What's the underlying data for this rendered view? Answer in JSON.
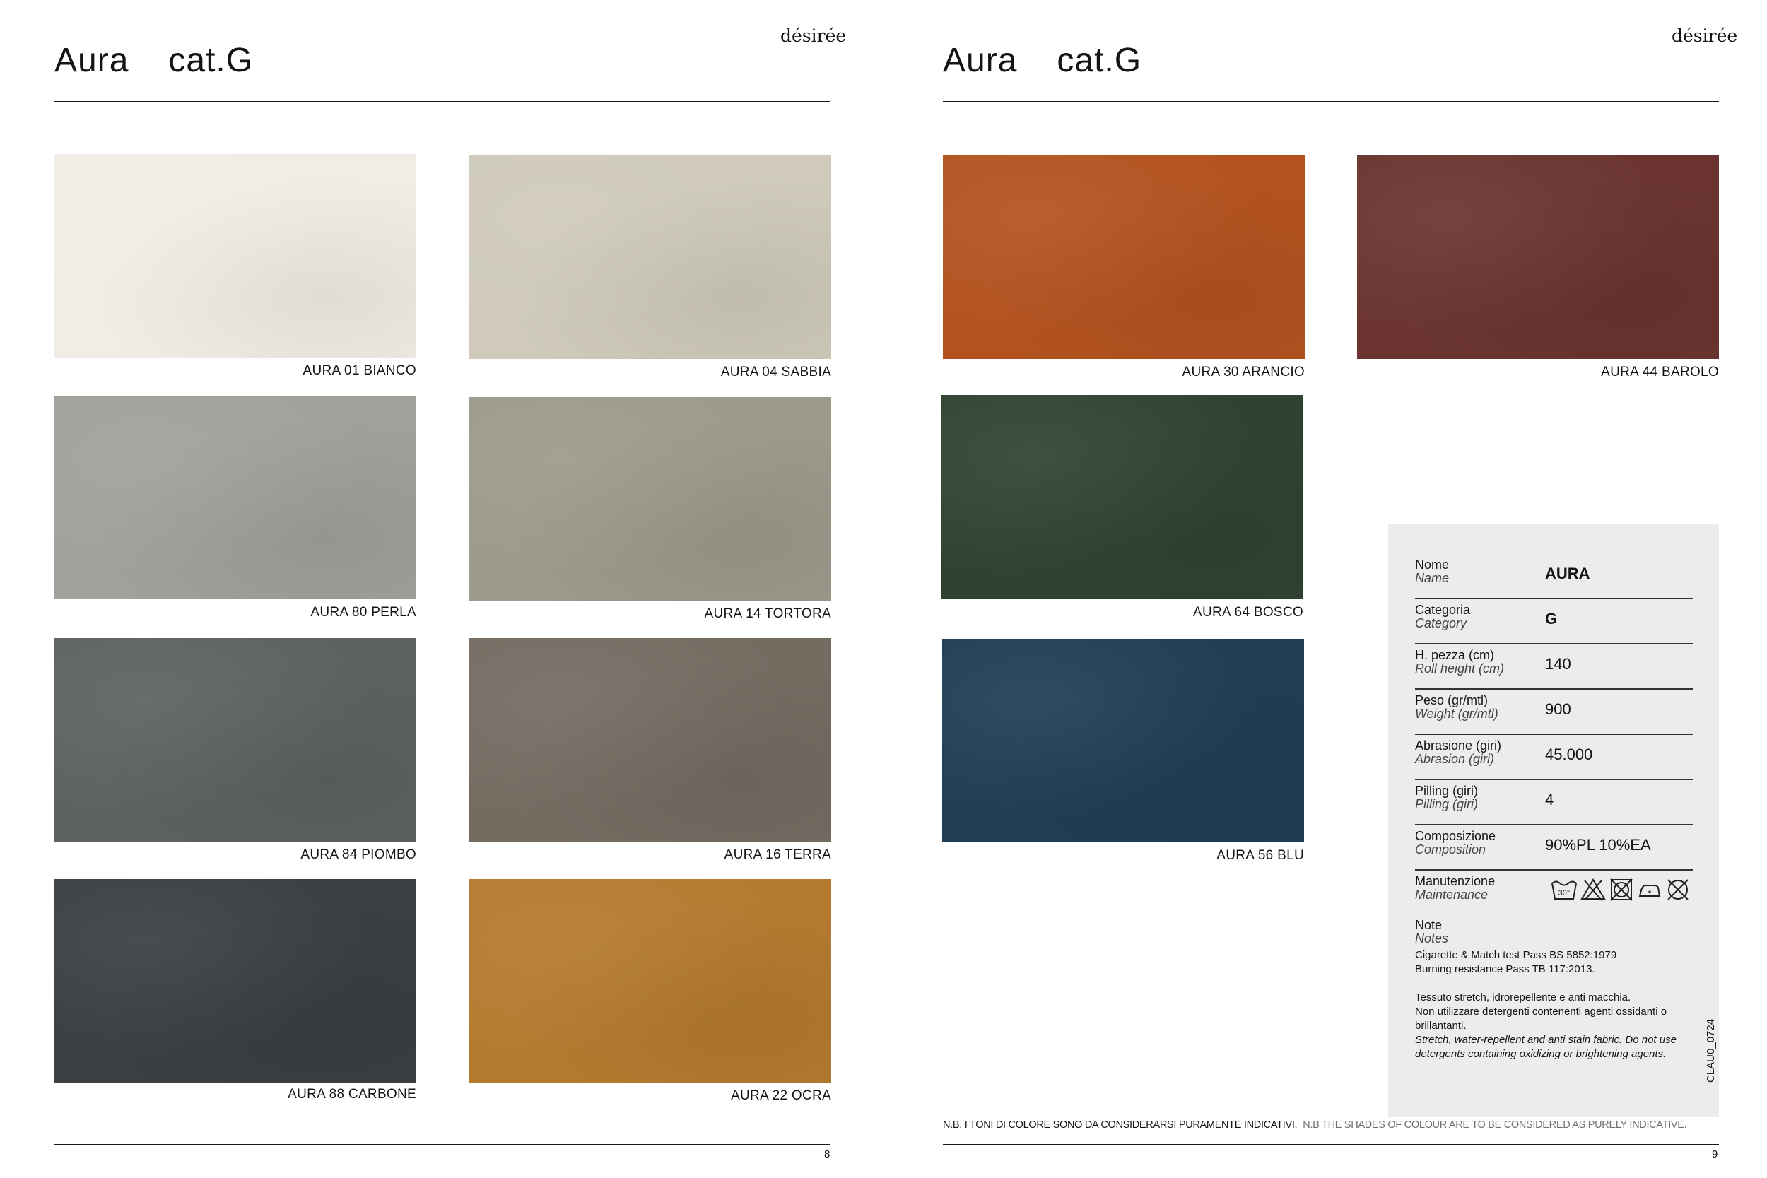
{
  "left_page": {
    "title": "Aura",
    "category": "cat.G",
    "brand": "désirée",
    "page_number": "8",
    "swatches": [
      {
        "label": "AURA 01 BIANCO",
        "color": "#f1ede4"
      },
      {
        "label": "AURA 04 SABBIA",
        "color": "#cfcab9"
      },
      {
        "label": "AURA 80 PERLA",
        "color": "#9ea29a"
      },
      {
        "label": "AURA 14 TORTORA",
        "color": "#9d998b"
      },
      {
        "label": "AURA 84 PIOMBO",
        "color": "#5c625f"
      },
      {
        "label": "AURA 16 TERRA",
        "color": "#746b61"
      },
      {
        "label": "AURA 88 CARBONE",
        "color": "#393f42"
      },
      {
        "label": "AURA 22 OCRA",
        "color": "#b47a30"
      }
    ]
  },
  "right_page": {
    "title": "Aura",
    "category": "cat.G",
    "brand": "désirée",
    "page_number": "9",
    "swatches": [
      {
        "label": "AURA 30 ARANCIO",
        "color": "#b3521f"
      },
      {
        "label": "AURA 44 BAROLO",
        "color": "#6b3430"
      },
      {
        "label": "AURA 64 BOSCO",
        "color": "#304331"
      },
      {
        "label": "AURA 56 BLU",
        "color": "#1f3e54"
      }
    ],
    "disclaimer_it": "N.B. I TONI DI COLORE SONO DA CONSIDERARSI PURAMENTE INDICATIVI.",
    "disclaimer_en": "N.B THE SHADES OF COLOUR ARE TO BE CONSIDERED AS PURELY INDICATIVE.",
    "spec": {
      "rows": [
        {
          "it": "Nome",
          "en": "Name",
          "value": "AURA"
        },
        {
          "it": "Categoria",
          "en": "Category",
          "value": "G"
        },
        {
          "it": "H. pezza (cm)",
          "en": "Roll height (cm)",
          "value": "140"
        },
        {
          "it": "Peso (gr/mtl)",
          "en": "Weight (gr/mtl)",
          "value": "900"
        },
        {
          "it": "Abrasione (giri)",
          "en": "Abrasion (giri)",
          "value": "45.000"
        },
        {
          "it": "Pilling (giri)",
          "en": "Pilling (giri)",
          "value": "4"
        },
        {
          "it": "Composizione",
          "en": "Composition",
          "value": "90%PL 10%EA"
        },
        {
          "it": "Manutenzione",
          "en": "Maintenance",
          "value": ""
        },
        {
          "it": "Note",
          "en": "Notes",
          "value": ""
        }
      ],
      "care_icons": [
        "wash-30-icon",
        "no-bleach-icon",
        "no-tumble-dry-icon",
        "iron-low-icon",
        "no-dry-clean-icon"
      ],
      "wash_temp": "30°",
      "fire_test_1": "Cigarette & Match test Pass BS 5852:1979",
      "fire_test_2": "Burning resistance Pass TB 117:2013.",
      "care_note_it_1": "Tessuto stretch, idrorepellente e anti macchia.",
      "care_note_it_2": "Non utilizzare detergenti contenenti agenti ossidanti o brillantanti.",
      "care_note_en": "Stretch, water-repellent and anti stain fabric. Do not use detergents containing oxidizing or brightening agents.",
      "code": "CLAU0_0724"
    }
  }
}
